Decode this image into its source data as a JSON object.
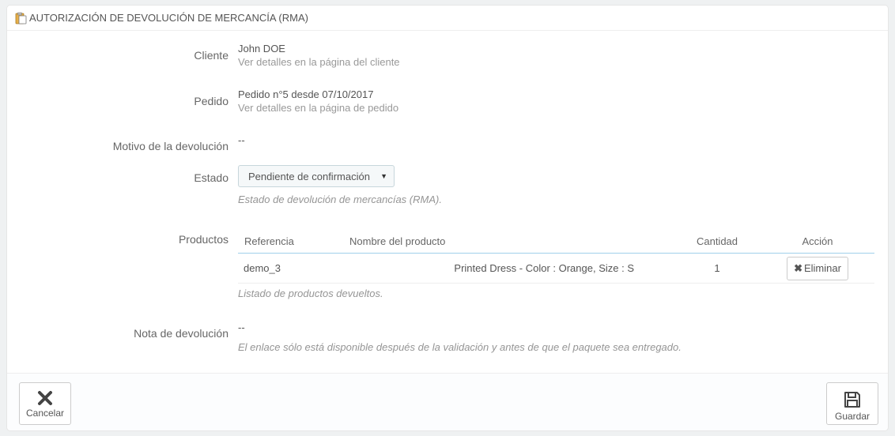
{
  "panel": {
    "title": "AUTORIZACIÓN DE DEVOLUCIÓN DE MERCANCÍA (RMA)"
  },
  "customer": {
    "label": "Cliente",
    "name": "John DOE",
    "link": "Ver detalles en la página del cliente"
  },
  "order": {
    "label": "Pedido",
    "text": "Pedido n°5 desde 07/10/2017",
    "link": "Ver detalles en la página de pedido"
  },
  "reason": {
    "label": "Motivo de la devolución",
    "value": "--"
  },
  "status": {
    "label": "Estado",
    "selected": "Pendiente de confirmación",
    "help": "Estado de devolución de mercancías (RMA)."
  },
  "products": {
    "label": "Productos",
    "headers": {
      "reference": "Referencia",
      "name": "Nombre del producto",
      "quantity": "Cantidad",
      "action": "Acción"
    },
    "rows": [
      {
        "reference": "demo_3",
        "name": "Printed Dress - Color : Orange, Size : S",
        "quantity": "1",
        "action": "Eliminar"
      }
    ],
    "help": "Listado de productos devueltos."
  },
  "note": {
    "label": "Nota de devolución",
    "value": "--",
    "help": "El enlace sólo está disponible después de la validación y antes de que el paquete sea entregado."
  },
  "footer": {
    "cancel": "Cancelar",
    "save": "Guardar"
  },
  "icons": {
    "title": "clipboard-icon",
    "delete": "times-icon",
    "cancel": "close-icon",
    "save": "floppy-disk-icon"
  }
}
